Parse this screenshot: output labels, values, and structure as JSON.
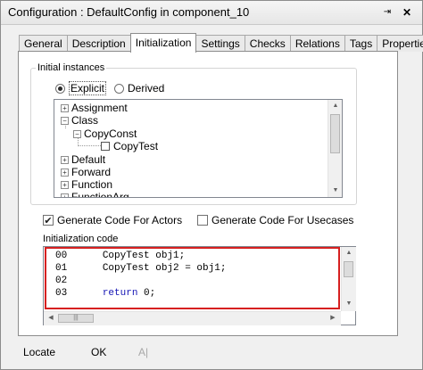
{
  "window": {
    "title": "Configuration : DefaultConfig in component_10",
    "pin_glyph": "⇥",
    "close_glyph": "✕"
  },
  "tabs": [
    {
      "label": "General",
      "active": false
    },
    {
      "label": "Description",
      "active": false
    },
    {
      "label": "Initialization",
      "active": true
    },
    {
      "label": "Settings",
      "active": false
    },
    {
      "label": "Checks",
      "active": false
    },
    {
      "label": "Relations",
      "active": false
    },
    {
      "label": "Tags",
      "active": false
    },
    {
      "label": "Properties",
      "active": false
    }
  ],
  "initial_instances": {
    "group_label": "Initial instances",
    "radio_explicit": "Explicit",
    "radio_derived": "Derived",
    "selected": "Explicit",
    "tree": [
      {
        "label": "Assignment",
        "expander": "+"
      },
      {
        "label": "Class",
        "expander": "−"
      },
      {
        "label": "CopyConst",
        "expander": "−"
      },
      {
        "label": "CopyTest",
        "expander": ""
      },
      {
        "label": "Default",
        "expander": "+"
      },
      {
        "label": "Forward",
        "expander": "+"
      },
      {
        "label": "Function",
        "expander": "+"
      },
      {
        "label": "FunctionArg",
        "expander": "+"
      }
    ]
  },
  "options": {
    "actors_label": "Generate Code For Actors",
    "actors_checked": true,
    "usecases_label": "Generate Code For Usecases",
    "usecases_checked": false,
    "check_glyph": "✔"
  },
  "init_code": {
    "label": "Initialization code",
    "lines": [
      {
        "num": "00",
        "code": "CopyTest obj1;"
      },
      {
        "num": "01",
        "code": "CopyTest obj2 = obj1;"
      },
      {
        "num": "02",
        "code": ""
      },
      {
        "num": "03",
        "keyword": "return",
        "code": " 0;"
      }
    ]
  },
  "buttons": {
    "locate": "Locate",
    "ok": "OK",
    "apply_partial": "A|"
  },
  "scroll": {
    "up": "▲",
    "down": "▼",
    "left": "◀",
    "right": "▶",
    "grip": "|||"
  }
}
